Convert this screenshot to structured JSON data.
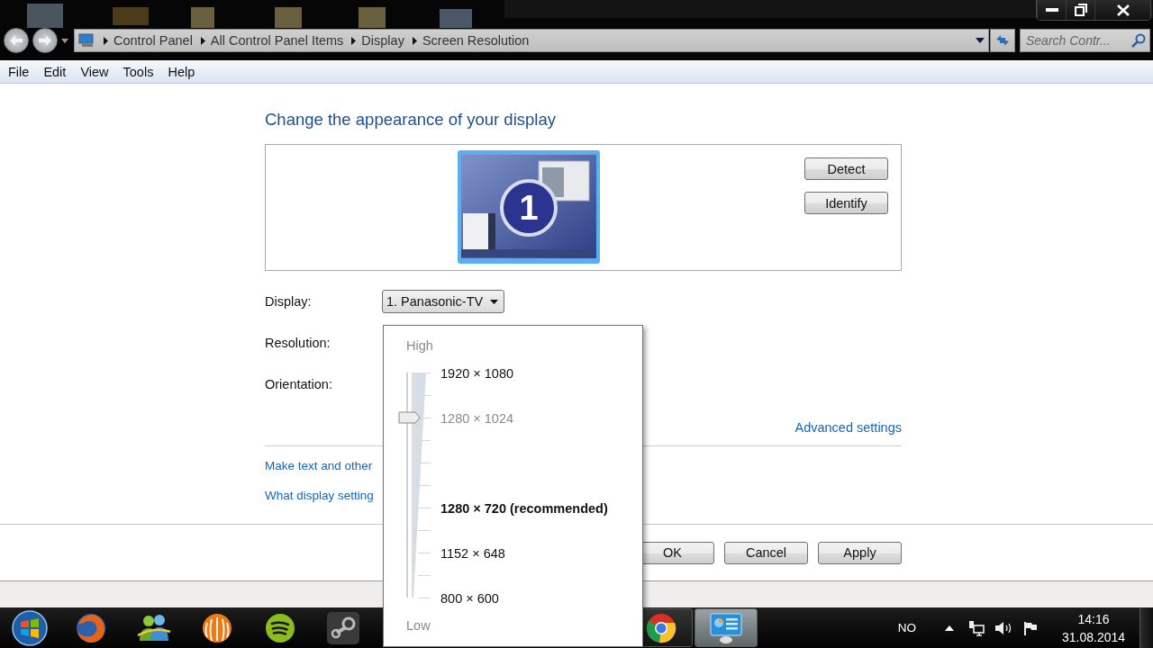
{
  "address_bar": {
    "breadcrumbs": [
      "Control Panel",
      "All Control Panel Items",
      "Display",
      "Screen Resolution"
    ]
  },
  "search": {
    "placeholder": "Search Contr..."
  },
  "menu": [
    "File",
    "Edit",
    "View",
    "Tools",
    "Help"
  ],
  "heading": "Change the appearance of your display",
  "monitor": {
    "number": "1"
  },
  "monitor_buttons": [
    "Detect",
    "Identify"
  ],
  "fields": [
    {
      "label": "Display:",
      "value": "1. Panasonic-TV"
    },
    {
      "label": "Resolution:"
    },
    {
      "label": "Orientation:"
    }
  ],
  "advanced_link": "Advanced settings",
  "links": [
    "Make text and other",
    "What display setting"
  ],
  "dialog_buttons": [
    "OK",
    "Cancel",
    "Apply"
  ],
  "resolution_popup": {
    "high_label": "High",
    "low_label": "Low",
    "level": 0.8,
    "ticks": [
      {
        "kind": "labeled",
        "label": "1920 × 1080",
        "selected": false,
        "recommended": false
      },
      {
        "kind": "blank",
        "selected": false
      },
      {
        "kind": "labeled",
        "label": "1280 × 1024",
        "selected": true,
        "recommended": false
      },
      {
        "kind": "blank",
        "selected": false
      },
      {
        "kind": "blank",
        "selected": false
      },
      {
        "kind": "blank",
        "selected": false
      },
      {
        "kind": "labeled",
        "label": "1280 × 720 (recommended)",
        "selected": false,
        "recommended": true
      },
      {
        "kind": "blank",
        "selected": false
      },
      {
        "kind": "labeled",
        "label": "1152 × 648",
        "selected": false,
        "recommended": false
      },
      {
        "kind": "blank",
        "selected": false
      },
      {
        "kind": "labeled",
        "label": "800 × 600",
        "selected": false,
        "recommended": false
      }
    ]
  },
  "taskbar": {
    "apps_left": [
      {
        "kind": "firefox",
        "running": false,
        "active": false
      },
      {
        "kind": "messenger",
        "running": false,
        "active": false
      },
      {
        "kind": "striped-ball",
        "running": false,
        "active": false
      },
      {
        "kind": "spotify",
        "running": false,
        "active": false
      },
      {
        "kind": "steam",
        "running": false,
        "active": false
      }
    ],
    "apps_right": [
      {
        "kind": "chrome",
        "running": true,
        "active": false
      },
      {
        "kind": "control-panel",
        "running": true,
        "active": true
      }
    ],
    "tray": {
      "language": "NO",
      "time": "14:16",
      "date": "31.08.2014"
    }
  }
}
